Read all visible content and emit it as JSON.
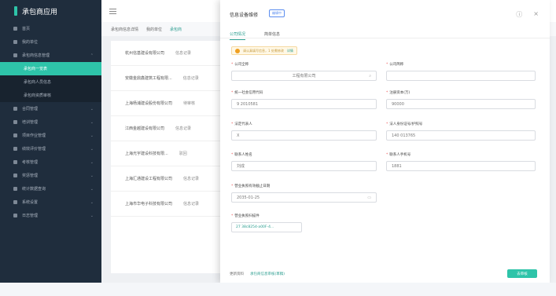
{
  "app": {
    "title": "承包商应用"
  },
  "sidebar": {
    "items": [
      {
        "label": "首页",
        "active": false,
        "sub": false
      },
      {
        "label": "我的单位",
        "active": false,
        "sub": false
      },
      {
        "label": "承包商信息管理",
        "active": false,
        "sub": false
      },
      {
        "label": "承包商一览表",
        "active": true,
        "sub": true
      },
      {
        "label": "承包商人员信息",
        "active": false,
        "sub": true
      },
      {
        "label": "承包商资质审核",
        "active": false,
        "sub": true
      },
      {
        "label": "合同管理",
        "active": false,
        "sub": false
      },
      {
        "label": "培训管理",
        "active": false,
        "sub": false
      },
      {
        "label": "项目作业管理",
        "active": false,
        "sub": false
      },
      {
        "label": "绩效评价管理",
        "active": false,
        "sub": false
      },
      {
        "label": "考核管理",
        "active": false,
        "sub": false
      },
      {
        "label": "奖惩管理",
        "active": false,
        "sub": false
      },
      {
        "label": "统计数据查询",
        "active": false,
        "sub": false
      },
      {
        "label": "系统设置",
        "active": false,
        "sub": false
      },
      {
        "label": "日志管理",
        "active": false,
        "sub": false
      }
    ]
  },
  "main": {
    "tabs": [
      "承包商信息详情",
      "我的单位",
      "承包商"
    ],
    "rows": [
      {
        "name": "杭州信基建设有限公司",
        "status": "信息记录"
      },
      {
        "name": "安徽金鼎鑫建筑工程有限...",
        "status": "信息记录"
      },
      {
        "name": "上海杨浦建设股份有限公司",
        "status": "待审核"
      },
      {
        "name": "江西金越建设有限公司",
        "status": "信息记录"
      },
      {
        "name": "上海光宇建设科技有限...",
        "status": "驳回"
      },
      {
        "name": "上海汇通建设工程有限公司",
        "status": "信息记录"
      },
      {
        "name": "上海市华电子科技有限公司",
        "status": "信息记录"
      }
    ]
  },
  "drawer": {
    "title": "信息设备维修",
    "badge": "编辑中",
    "tabs": [
      "公司情况",
      "简单信息"
    ],
    "notice": {
      "text": "请认真填写信息，1 处需修改",
      "link": "详情"
    },
    "fields": {
      "company_name": {
        "label": "公司全称",
        "value": "工程有限公司",
        "required": true
      },
      "company_short": {
        "label": "公司简称",
        "value": "",
        "required": true
      },
      "credit_code": {
        "label": "统一社会信用代码",
        "value": "9          2010581",
        "required": true
      },
      "reg_capital": {
        "label": "注册资本(万)",
        "value": "90000",
        "required": true
      },
      "legal_rep": {
        "label": "法定代表人",
        "value": "X",
        "required": true
      },
      "legal_id": {
        "label": "法人身份证号/护照号",
        "value": "140            013765",
        "required": true
      },
      "contact_name": {
        "label": "联系人姓名",
        "value": "刘成",
        "required": true
      },
      "contact_phone": {
        "label": "联系人手机号",
        "value": "1881",
        "required": true
      },
      "license_expiry": {
        "label": "营业执照有效截止日期",
        "value": "2035-01-25",
        "required": true
      },
      "license_file": {
        "label": "营业执照扫描件",
        "value": "27  38c8254-a00F-4...",
        "required": true
      }
    },
    "footer": {
      "text": "更新资料",
      "link": "承包商信息审核(草稿)",
      "button": "去审核"
    }
  }
}
